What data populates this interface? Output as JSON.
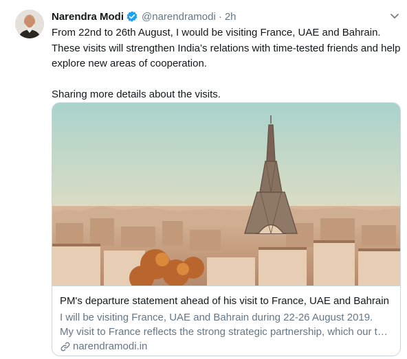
{
  "author": {
    "name": "Narendra Modi",
    "handle": "@narendramodi",
    "separator": "·",
    "time": "2h"
  },
  "tweet": {
    "paragraph1": "From 22nd to 26th August, I would be visiting France, UAE and Bahrain. These visits will strengthen India’s relations with time-tested friends and help explore new areas of cooperation.",
    "paragraph2": "Sharing more details about the visits."
  },
  "card": {
    "title": "PM's departure statement ahead of his visit to France, UAE and Bahrain",
    "description_line1": "I will be visiting France, UAE and Bahrain during 22-26 August 2019.",
    "description_line2": "My visit to France reflects the strong strategic partnership, which our two countries share.",
    "domain": "narendramodi.in"
  },
  "icons": {
    "verified": "verified-badge-icon",
    "menu": "chevron-down-icon",
    "link": "link-icon"
  },
  "colors": {
    "accent": "#1da1f2",
    "secondary_text": "#657786",
    "border": "#ccd6dd"
  }
}
